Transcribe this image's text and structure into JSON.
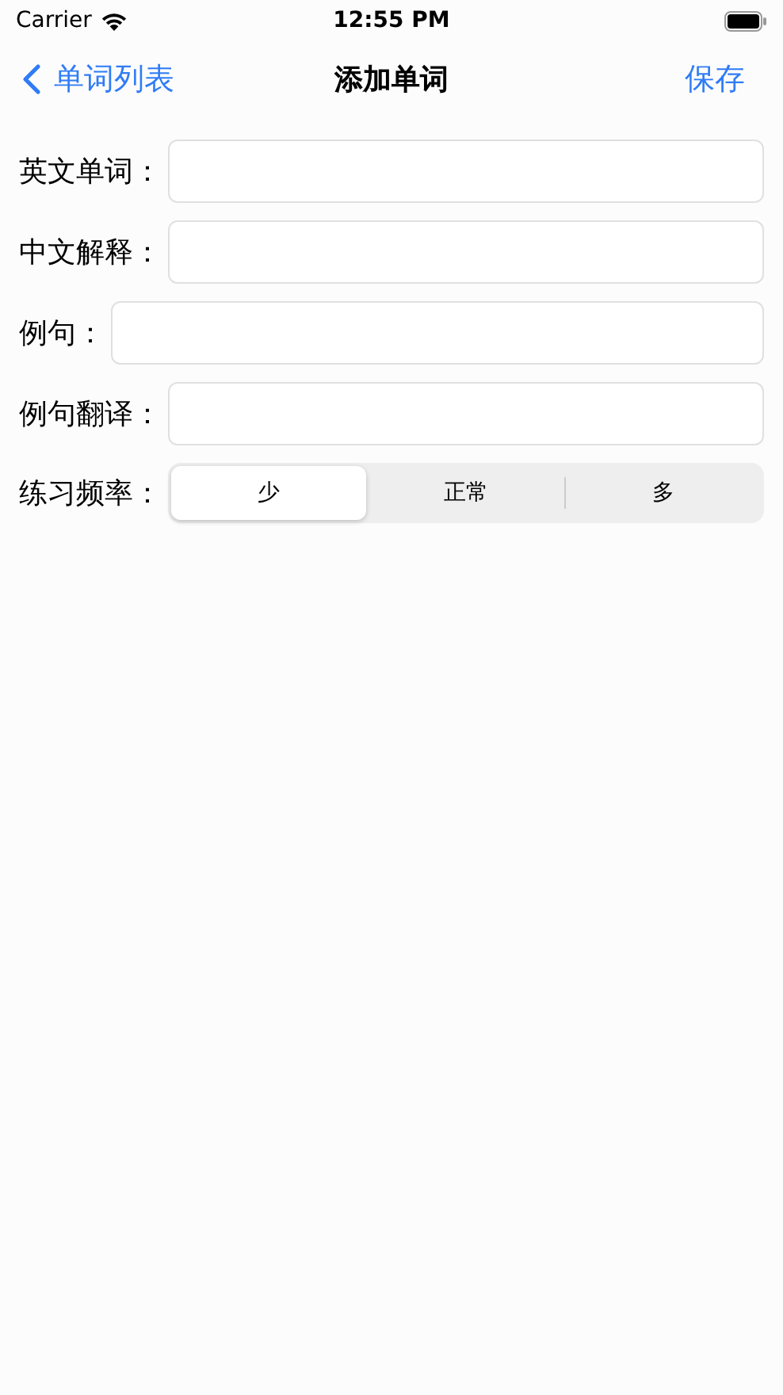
{
  "status_bar": {
    "carrier": "Carrier",
    "time": "12:55 PM"
  },
  "nav": {
    "back_label": "单词列表",
    "title": "添加单词",
    "action": "保存"
  },
  "fields": [
    {
      "label": "英文单词："
    },
    {
      "label": "中文解释："
    },
    {
      "label": "例句："
    },
    {
      "label": "例句翻译："
    }
  ],
  "frequency": {
    "label": "练习频率：",
    "segments": [
      {
        "label": "少",
        "selected": true
      },
      {
        "label": "正常",
        "selected": false
      },
      {
        "label": "多",
        "selected": false
      }
    ]
  }
}
